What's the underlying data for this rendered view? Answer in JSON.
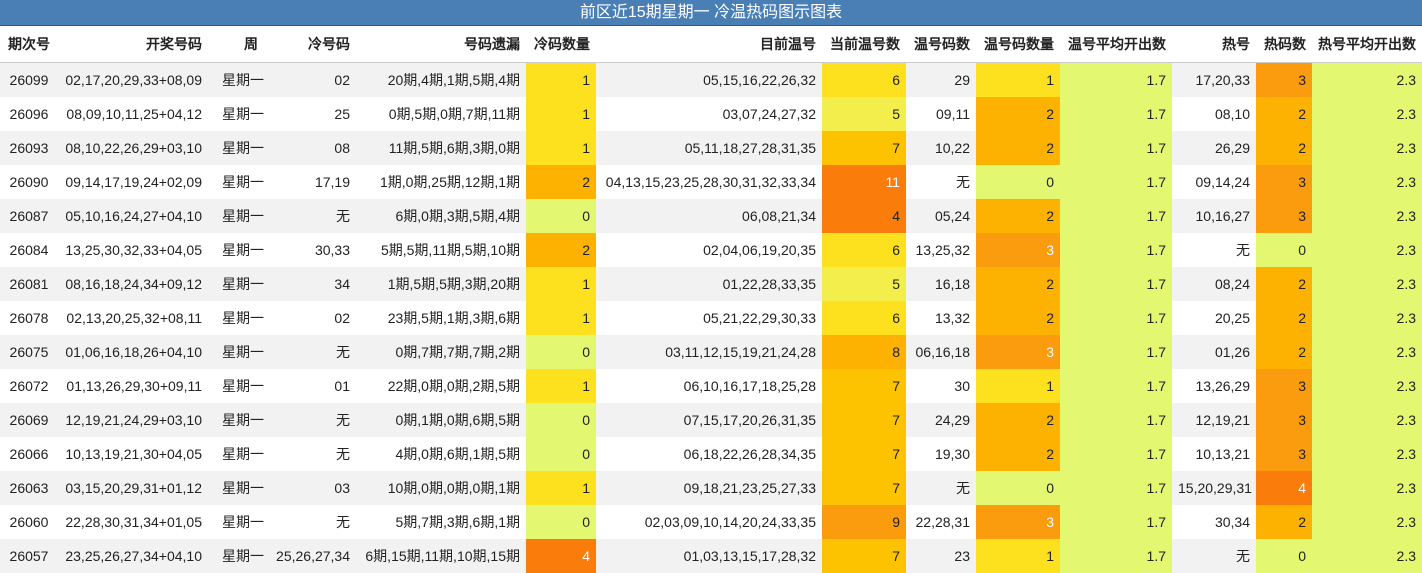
{
  "title": "前区近15期星期一 冷温热码图示图表",
  "colors": {
    "header_bg": "#4a7fb6",
    "scale": {
      "0": "#e3f771",
      "1": "#fde11f",
      "2": "#fdb100",
      "3": "#fb9c0e",
      "4": "#fa7d0b",
      "5": "#f3ee4c",
      "6": "#fde11f",
      "7": "#fdc300",
      "8": "#fdb100",
      "9": "#fb9c0e",
      "11": "#fa7d0b",
      "avg": "#e3f771"
    }
  },
  "chart_data": {
    "type": "table",
    "columns": [
      "期次号",
      "开奖号码",
      "周",
      "冷号码",
      "号码遗漏",
      "冷码数量",
      "目前温号",
      "当前温号数",
      "温号码数",
      "温号码数量",
      "温号平均开出数",
      "热号",
      "热码数",
      "热号平均开出数"
    ],
    "rows": [
      [
        "26099",
        "02,17,20,29,33+08,09",
        "星期一",
        "02",
        "20期,4期,1期,5期,4期",
        "1",
        "05,15,16,22,26,32",
        "6",
        "29",
        "1",
        "1.7",
        "17,20,33",
        "3",
        "2.3"
      ],
      [
        "26096",
        "08,09,10,11,25+04,12",
        "星期一",
        "25",
        "0期,5期,0期,7期,11期",
        "1",
        "03,07,24,27,32",
        "5",
        "09,11",
        "2",
        "1.7",
        "08,10",
        "2",
        "2.3"
      ],
      [
        "26093",
        "08,10,22,26,29+03,10",
        "星期一",
        "08",
        "11期,5期,6期,3期,0期",
        "1",
        "05,11,18,27,28,31,35",
        "7",
        "10,22",
        "2",
        "1.7",
        "26,29",
        "2",
        "2.3"
      ],
      [
        "26090",
        "09,14,17,19,24+02,09",
        "星期一",
        "17,19",
        "1期,0期,25期,12期,1期",
        "2",
        "04,13,15,23,25,28,30,31,32,33,34",
        "11",
        "无",
        "0",
        "1.7",
        "09,14,24",
        "3",
        "2.3"
      ],
      [
        "26087",
        "05,10,16,24,27+04,10",
        "星期一",
        "无",
        "6期,0期,3期,5期,4期",
        "0",
        "06,08,21,34",
        "4",
        "05,24",
        "2",
        "1.7",
        "10,16,27",
        "3",
        "2.3"
      ],
      [
        "26084",
        "13,25,30,32,33+04,05",
        "星期一",
        "30,33",
        "5期,5期,11期,5期,10期",
        "2",
        "02,04,06,19,20,35",
        "6",
        "13,25,32",
        "3",
        "1.7",
        "无",
        "0",
        "2.3"
      ],
      [
        "26081",
        "08,16,18,24,34+09,12",
        "星期一",
        "34",
        "1期,5期,5期,3期,20期",
        "1",
        "01,22,28,33,35",
        "5",
        "16,18",
        "2",
        "1.7",
        "08,24",
        "2",
        "2.3"
      ],
      [
        "26078",
        "02,13,20,25,32+08,11",
        "星期一",
        "02",
        "23期,5期,1期,3期,6期",
        "1",
        "05,21,22,29,30,33",
        "6",
        "13,32",
        "2",
        "1.7",
        "20,25",
        "2",
        "2.3"
      ],
      [
        "26075",
        "01,06,16,18,26+04,10",
        "星期一",
        "无",
        "0期,7期,7期,7期,2期",
        "0",
        "03,11,12,15,19,21,24,28",
        "8",
        "06,16,18",
        "3",
        "1.7",
        "01,26",
        "2",
        "2.3"
      ],
      [
        "26072",
        "01,13,26,29,30+09,11",
        "星期一",
        "01",
        "22期,0期,0期,2期,5期",
        "1",
        "06,10,16,17,18,25,28",
        "7",
        "30",
        "1",
        "1.7",
        "13,26,29",
        "3",
        "2.3"
      ],
      [
        "26069",
        "12,19,21,24,29+03,10",
        "星期一",
        "无",
        "0期,1期,0期,6期,5期",
        "0",
        "07,15,17,20,26,31,35",
        "7",
        "24,29",
        "2",
        "1.7",
        "12,19,21",
        "3",
        "2.3"
      ],
      [
        "26066",
        "10,13,19,21,30+04,05",
        "星期一",
        "无",
        "4期,0期,6期,1期,5期",
        "0",
        "06,18,22,26,28,34,35",
        "7",
        "19,30",
        "2",
        "1.7",
        "10,13,21",
        "3",
        "2.3"
      ],
      [
        "26063",
        "03,15,20,29,31+01,12",
        "星期一",
        "03",
        "10期,0期,0期,0期,1期",
        "1",
        "09,18,21,23,25,27,33",
        "7",
        "无",
        "0",
        "1.7",
        "15,20,29,31",
        "4",
        "2.3"
      ],
      [
        "26060",
        "22,28,30,31,34+01,05",
        "星期一",
        "无",
        "5期,7期,3期,6期,1期",
        "0",
        "02,03,09,10,14,20,24,33,35",
        "9",
        "22,28,31",
        "3",
        "1.7",
        "30,34",
        "2",
        "2.3"
      ],
      [
        "26057",
        "23,25,26,27,34+04,10",
        "星期一",
        "25,26,27,34",
        "6期,15期,11期,10期,15期",
        "4",
        "01,03,13,15,17,28,32",
        "7",
        "23",
        "1",
        "1.7",
        "无",
        "0",
        "2.3"
      ]
    ]
  }
}
